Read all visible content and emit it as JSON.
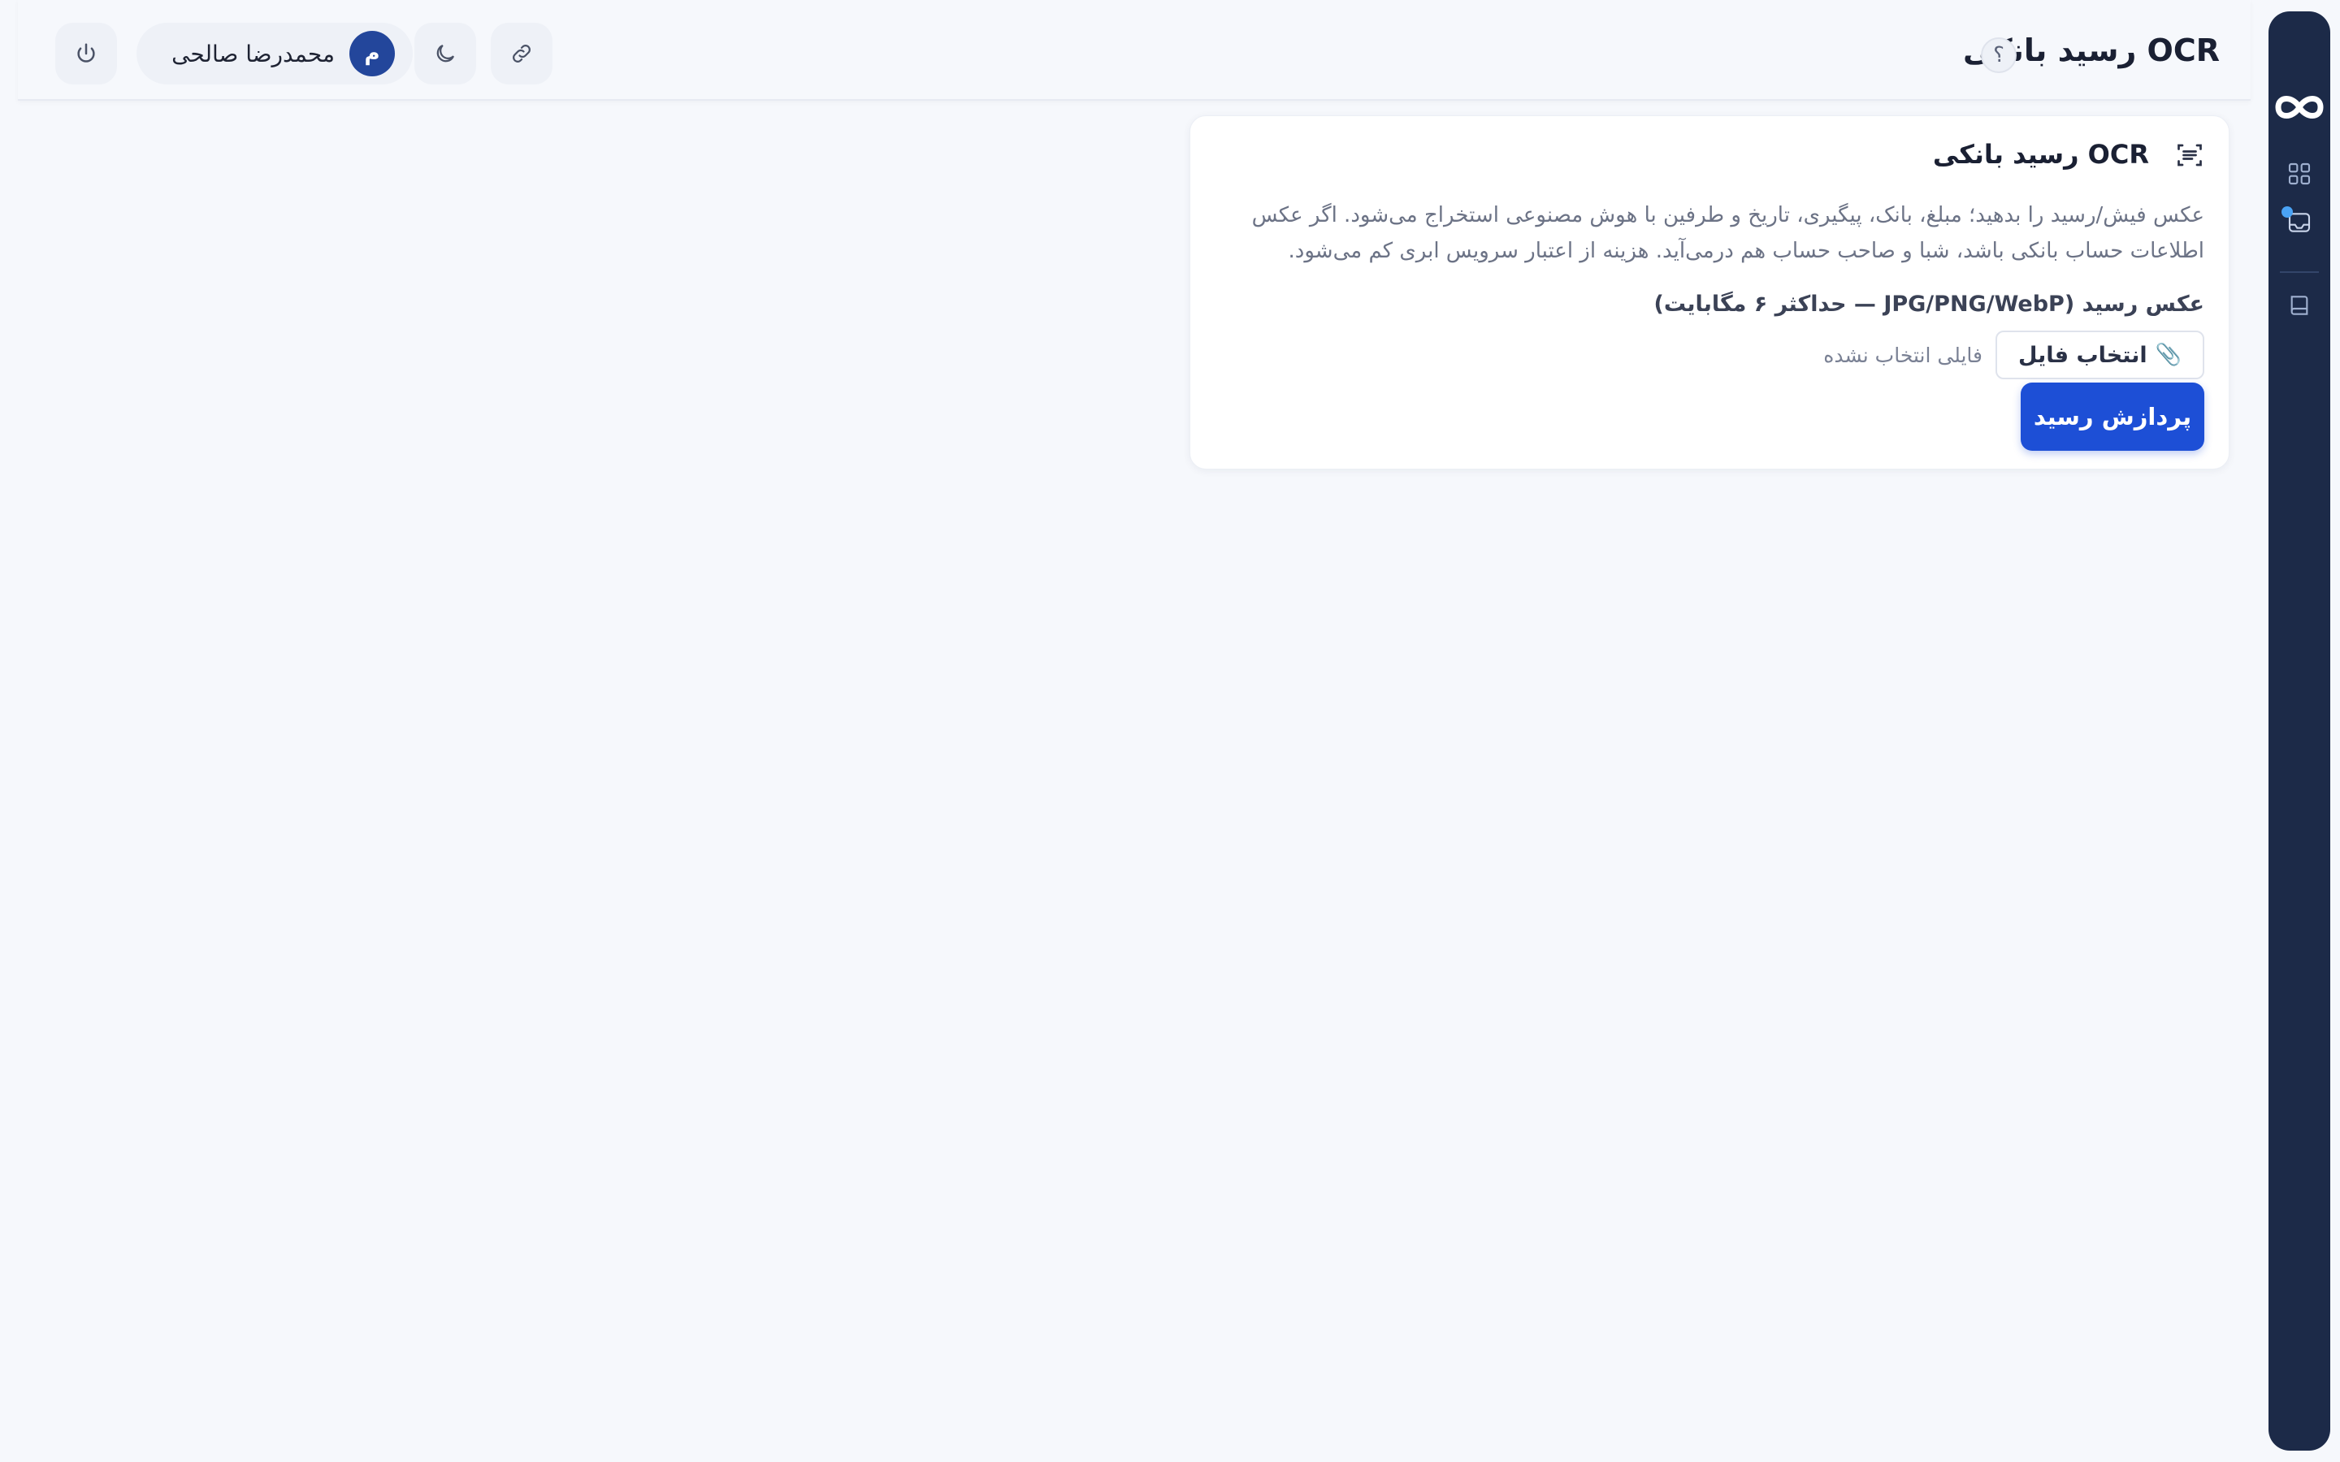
{
  "header": {
    "title": "OCR رسید بانکی",
    "help": "؟",
    "user_name": "محمدرضا صالحی",
    "avatar_initial": "م"
  },
  "card": {
    "title": "OCR رسید بانکی",
    "description": "عکس فیش/رسید را بدهید؛ مبلغ، بانک، پیگیری، تاریخ و طرفین با هوش مصنوعی استخراج می‌شود. اگر عکس اطلاعات حساب بانکی باشد، شبا و صاحب حساب هم درمی‌آید. هزینه از اعتبار سرویس ابری کم می‌شود.",
    "field_label": "عکس رسید (JPG/PNG/WebP — حداکثر ۶ مگابایت)",
    "choose_file": "انتخاب فایل",
    "file_status": "فایلی انتخاب نشده",
    "process_button": "پردازش رسید"
  },
  "colors": {
    "sidebar": "#1c2a48",
    "primary": "#1d4fd6",
    "avatar": "#23469b",
    "notification_dot": "#4aa3f5",
    "background": "#f6f8fc"
  },
  "icons": {
    "logo": "infinity-logo-icon",
    "sidebar": [
      "dashboard-grid-icon",
      "receipt-inbox-icon",
      "book-icon"
    ],
    "header": [
      "power-icon",
      "moon-icon",
      "link-icon"
    ],
    "card": "scan-text-icon",
    "attachment": "paperclip-icon"
  }
}
